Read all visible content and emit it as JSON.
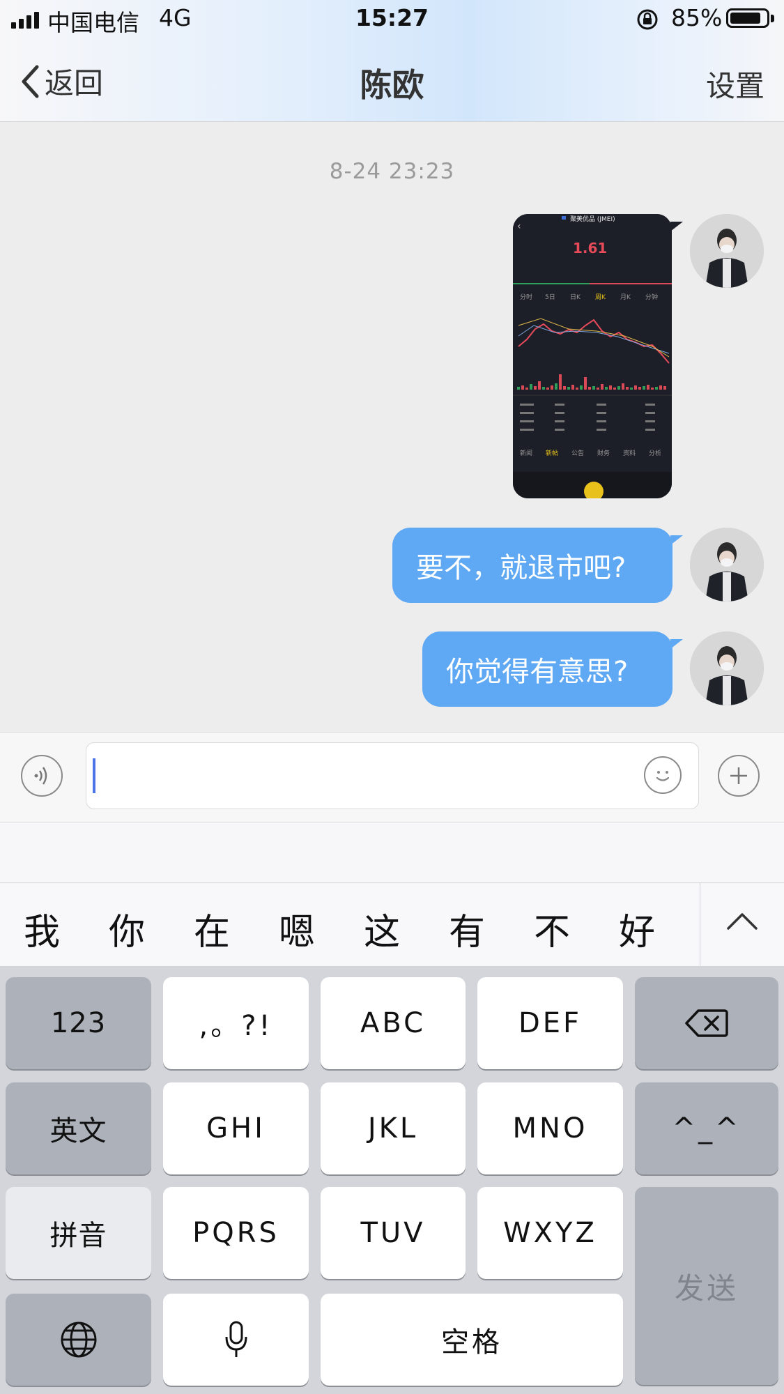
{
  "status_bar": {
    "carrier": "中国电信",
    "network": "4G",
    "time": "15:27",
    "battery_percent": "85%",
    "battery_level": 0.85
  },
  "nav": {
    "back_label": "返回",
    "title": "陈欧",
    "settings_label": "设置"
  },
  "chat": {
    "timestamp": "8-24 23:23",
    "stock_screenshot": {
      "name": "聚美优品 (JMEI)",
      "price": "1.61",
      "tabs": [
        "分时",
        "5日",
        "日K",
        "周K",
        "月K",
        "分钟"
      ],
      "bottom_tabs": [
        "新闻",
        "新帖",
        "公告",
        "财务",
        "资料",
        "分析"
      ]
    },
    "messages": [
      {
        "text": "要不，就退市吧?"
      },
      {
        "text": "你觉得有意思?"
      }
    ],
    "bubble_color": "#5ea8f4"
  },
  "candidates": [
    "我",
    "你",
    "在",
    "嗯",
    "这",
    "有",
    "不",
    "好"
  ],
  "keyboard": {
    "row1": [
      "123",
      ",。?!",
      "ABC",
      "DEF"
    ],
    "row2": [
      "英文",
      "GHI",
      "JKL",
      "MNO",
      "^_^"
    ],
    "row3": [
      "拼音",
      "PQRS",
      "TUV",
      "WXYZ"
    ],
    "space_label": "空格",
    "send_label": "发送"
  },
  "icons": {
    "voice": "voice-icon",
    "emoji": "emoji-icon",
    "add": "plus-icon",
    "delete": "backspace-icon",
    "globe": "globe-icon",
    "mic": "microphone-icon",
    "collapse": "chevron-up-icon"
  }
}
